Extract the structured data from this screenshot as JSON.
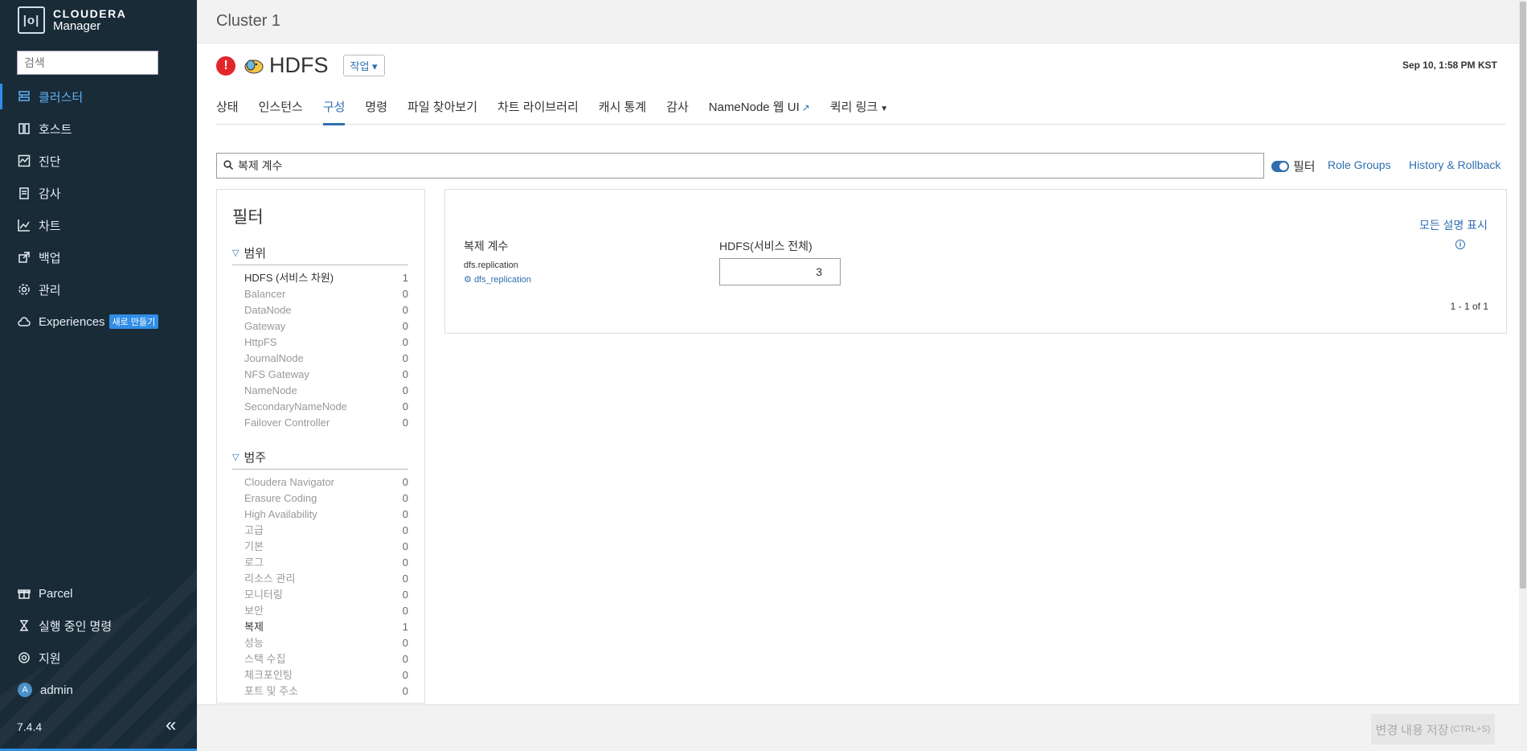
{
  "app": {
    "logo_mark": "|o|",
    "brand_line1": "CLOUDERA",
    "brand_line2": "Manager"
  },
  "sidebar": {
    "search_placeholder": "검색",
    "items": [
      {
        "label": "클러스터",
        "icon": "cluster-icon",
        "active": true
      },
      {
        "label": "호스트",
        "icon": "hosts-icon"
      },
      {
        "label": "진단",
        "icon": "diagnostics-icon"
      },
      {
        "label": "감사",
        "icon": "audit-icon"
      },
      {
        "label": "차트",
        "icon": "chart-icon"
      },
      {
        "label": "백업",
        "icon": "backup-icon"
      },
      {
        "label": "관리",
        "icon": "gear-icon"
      },
      {
        "label": "Experiences",
        "icon": "cloud-icon",
        "badge": "새로 만들기"
      }
    ],
    "bottom_items": [
      {
        "label": "Parcel",
        "icon": "gift-icon"
      },
      {
        "label": "실행 중인 명령",
        "icon": "hourglass-icon"
      },
      {
        "label": "지원",
        "icon": "lifebuoy-icon"
      },
      {
        "label": "admin",
        "icon": "avatar",
        "avatar_letter": "A"
      }
    ],
    "version": "7.4.4",
    "collapse_glyph": "«"
  },
  "cluster": {
    "name": "Cluster 1"
  },
  "service": {
    "status_glyph": "!",
    "name": "HDFS",
    "action_label": "작업",
    "timestamp": "Sep 10, 1:58 PM KST"
  },
  "tabs": [
    {
      "label": "상태"
    },
    {
      "label": "인스턴스"
    },
    {
      "label": "구성",
      "active": true
    },
    {
      "label": "명령"
    },
    {
      "label": "파일 찾아보기"
    },
    {
      "label": "차트 라이브러리"
    },
    {
      "label": "캐시 통계"
    },
    {
      "label": "감사"
    },
    {
      "label": "NameNode 웹 UI",
      "external": true
    },
    {
      "label": "퀵리 링크",
      "dropdown": true
    }
  ],
  "config_search": {
    "value": "복제 계수"
  },
  "toolbar": {
    "filter_label": "필터",
    "role_groups": "Role Groups",
    "history": "History & Rollback"
  },
  "filter_panel": {
    "title": "필터",
    "groups": [
      {
        "title": "범위",
        "rows": [
          {
            "label": "HDFS (서비스 차원)",
            "count": "1",
            "on": true
          },
          {
            "label": "Balancer",
            "count": "0"
          },
          {
            "label": "DataNode",
            "count": "0"
          },
          {
            "label": "Gateway",
            "count": "0"
          },
          {
            "label": "HttpFS",
            "count": "0"
          },
          {
            "label": "JournalNode",
            "count": "0"
          },
          {
            "label": "NFS Gateway",
            "count": "0"
          },
          {
            "label": "NameNode",
            "count": "0"
          },
          {
            "label": "SecondaryNameNode",
            "count": "0"
          },
          {
            "label": "Failover Controller",
            "count": "0"
          }
        ]
      },
      {
        "title": "범주",
        "rows": [
          {
            "label": "Cloudera Navigator",
            "count": "0"
          },
          {
            "label": "Erasure Coding",
            "count": "0"
          },
          {
            "label": "High Availability",
            "count": "0"
          },
          {
            "label": "고급",
            "count": "0"
          },
          {
            "label": "기본",
            "count": "0"
          },
          {
            "label": "로그",
            "count": "0"
          },
          {
            "label": "리소스 관리",
            "count": "0"
          },
          {
            "label": "모니터링",
            "count": "0"
          },
          {
            "label": "보안",
            "count": "0"
          },
          {
            "label": "복제",
            "count": "1",
            "on": true
          },
          {
            "label": "성능",
            "count": "0"
          },
          {
            "label": "스택 수집",
            "count": "0"
          },
          {
            "label": "체크포인팅",
            "count": "0"
          },
          {
            "label": "포트 및 주소",
            "count": "0"
          }
        ]
      }
    ]
  },
  "config": {
    "show_all_desc": "모든 설명 표시",
    "label": "복제 계수",
    "key": "dfs.replication",
    "param": "dfs_replication",
    "scope": "HDFS(서비스 전체)",
    "value": "3",
    "pager": "1 - 1 of 1"
  },
  "footer": {
    "save_label": "변경 내용 저장",
    "save_shortcut": "(CTRL+S)"
  }
}
